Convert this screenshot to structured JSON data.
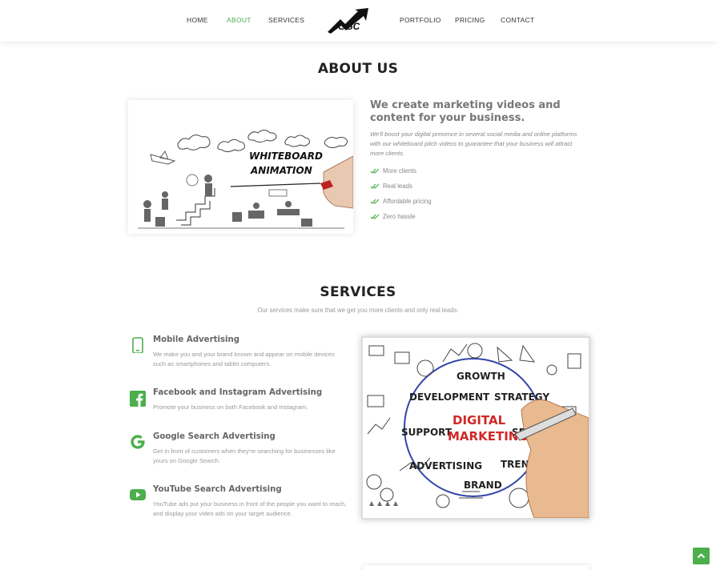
{
  "nav": {
    "items": [
      "HOME",
      "ABOUT",
      "SERVICES",
      "PORTFOLIO",
      "PRICING",
      "CONTACT"
    ],
    "active": "ABOUT",
    "logo_text": "GGC",
    "accent_color": "#4cae4c"
  },
  "about": {
    "title": "ABOUT US",
    "heading": "We create marketing videos and content for your business.",
    "description": "We'll boost your digital presence in several social media and online platforms with our whiteboard pitch videos to guarantee that your business will attract more clients.",
    "features": [
      "More clients",
      "Real leads",
      "Affordable pricing",
      "Zero hassle"
    ],
    "image_caption_line1": "WHITEBOARD",
    "image_caption_line2": "ANIMATION"
  },
  "services": {
    "title": "SERVICES",
    "subtitle": "Our services make sure that we get you more clients and only real leads.",
    "items": [
      {
        "icon": "mobile-icon",
        "title": "Mobile Advertising",
        "description": "We make you and your brand known and appear on mobile devices such as smartphones and tablet computers."
      },
      {
        "icon": "facebook-icon",
        "title": "Facebook and Instagram Advertising",
        "description": "Promote your business on both Facebook and Instagram."
      },
      {
        "icon": "google-icon",
        "title": "Google Search Advertising",
        "description": "Get in front of customers when they're searching for businesses like yours on Google Search."
      },
      {
        "icon": "youtube-icon",
        "title": "YouTube Search Advertising",
        "description": "YouTube ads put your business in front of the people you want to reach, and display your video ads on your target audience."
      }
    ],
    "image_words": {
      "center1": "DIGITAL",
      "center2": "MARKETING",
      "growth": "GROWTH",
      "development": "DEVELOPMENT",
      "strategy": "STRATEGY",
      "support": "SUPPORT",
      "service": "SERVICE",
      "advertising": "ADVERTISING",
      "trend": "TREND",
      "brand": "BRAND"
    }
  },
  "scroll_top": {
    "icon": "chevron-up-icon"
  }
}
